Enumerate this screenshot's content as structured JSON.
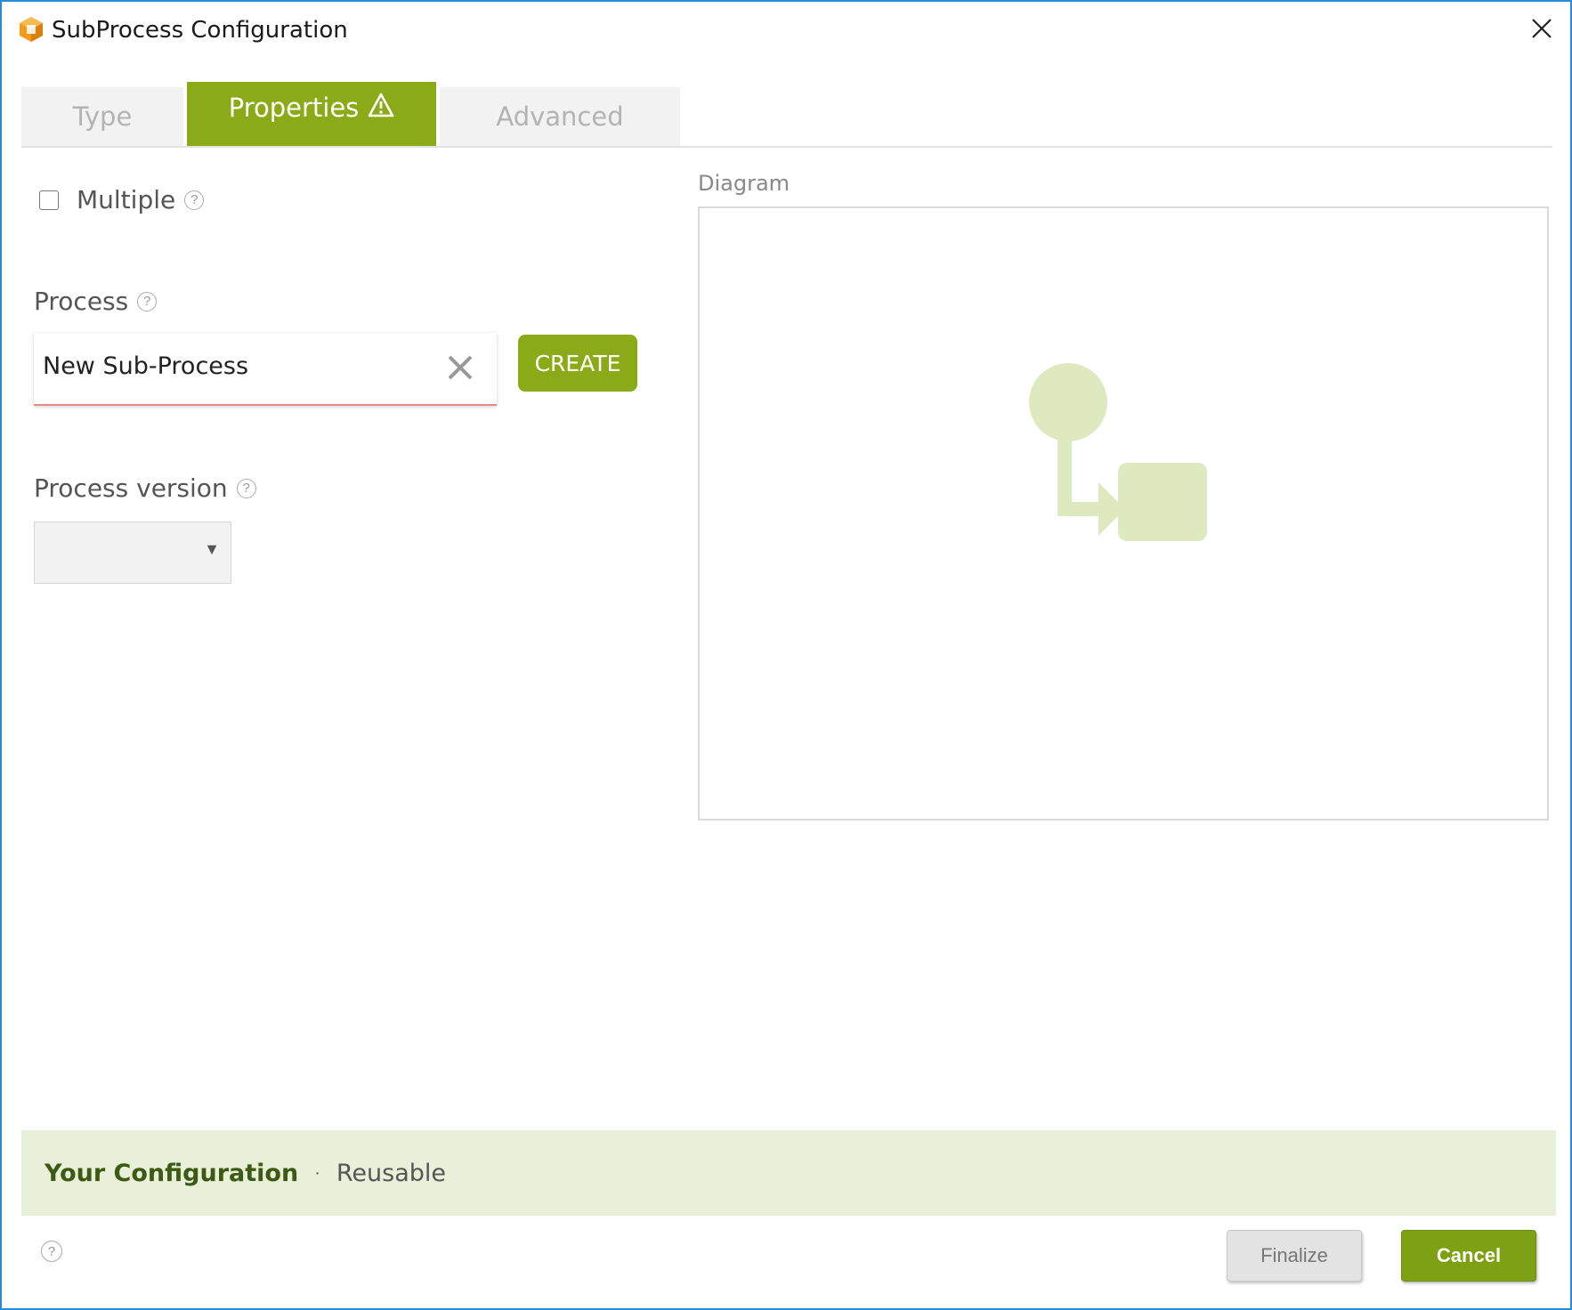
{
  "window": {
    "title": "SubProcess Configuration",
    "app_icon": "process-cube-icon",
    "close_icon": "close-icon"
  },
  "tabs": [
    {
      "label": "Type",
      "active": false
    },
    {
      "label": "Properties",
      "active": true,
      "icon": "warning-triangle-icon"
    },
    {
      "label": "Advanced",
      "active": false
    }
  ],
  "form": {
    "multiple": {
      "label": "Multiple",
      "checked": false,
      "help_icon": "help-icon"
    },
    "process": {
      "label": "Process",
      "value": "New Sub-Process",
      "clear_icon": "clear-icon",
      "create_label": "CREATE"
    },
    "process_version": {
      "label": "Process version",
      "selected": "",
      "arrow": "▼"
    }
  },
  "diagram": {
    "label": "Diagram",
    "placeholder_icon": "subprocess-diagram-icon"
  },
  "configuration": {
    "title": "Your Configuration",
    "separator": "·",
    "value": "Reusable"
  },
  "footer": {
    "help_icon": "help-icon",
    "finalize_label": "Finalize",
    "cancel_label": "Cancel"
  },
  "colors": {
    "accent": "#8aab17",
    "window_border": "#2b8ad8",
    "config_bar": "#e9f0da",
    "diagram_shape": "#dfe9c0"
  }
}
